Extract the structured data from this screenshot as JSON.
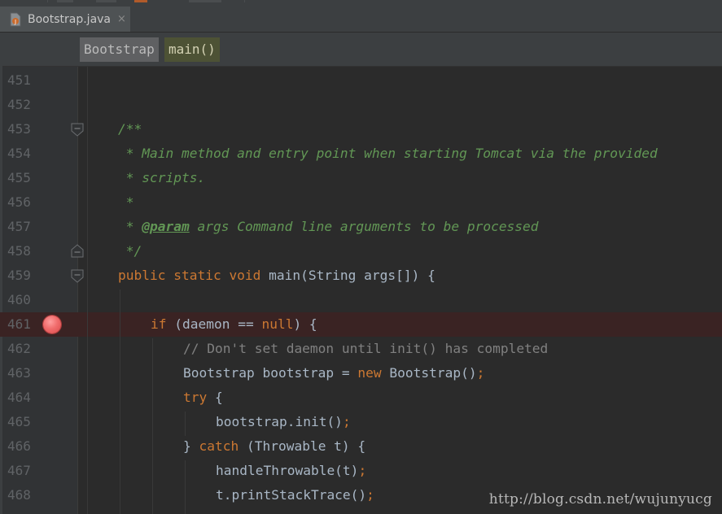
{
  "tab": {
    "title": "Bootstrap.java",
    "close": "×"
  },
  "breadcrumb": {
    "class_name": "Bootstrap",
    "method_name": "main()"
  },
  "lines": [
    {
      "n": "451"
    },
    {
      "n": "452"
    },
    {
      "n": "453"
    },
    {
      "n": "454"
    },
    {
      "n": "455"
    },
    {
      "n": "456"
    },
    {
      "n": "457"
    },
    {
      "n": "458"
    },
    {
      "n": "459"
    },
    {
      "n": "460"
    },
    {
      "n": "461"
    },
    {
      "n": "462"
    },
    {
      "n": "463"
    },
    {
      "n": "464"
    },
    {
      "n": "465"
    },
    {
      "n": "466"
    },
    {
      "n": "467"
    },
    {
      "n": "468"
    }
  ],
  "code": {
    "l453": "/**",
    "l454": " * Main method and entry point when starting Tomcat via the provided",
    "l455": " * scripts.",
    "l456": " *",
    "l457_star": " * ",
    "l457_tag": "@param",
    "l457_rest": " args Command line arguments to be processed",
    "l458": " */",
    "l459_kw": "public static void",
    "l459_rest": " main(String args[]) {",
    "l461_kw": "if",
    "l461_a": " (daemon == ",
    "l461_null": "null",
    "l461_b": ") {",
    "l462": "// Don't set daemon until init() has completed",
    "l463_a": "Bootstrap bootstrap = ",
    "l463_new": "new",
    "l463_b": " Bootstrap()",
    "l464_kw": "try",
    "l464_b": " {",
    "l465": "bootstrap.init()",
    "l466_a": "} ",
    "l466_kw": "catch",
    "l466_b": " (Throwable t) {",
    "l467": "handleThrowable(t)",
    "l468": "t.printStackTrace()",
    "semicolon": ";"
  },
  "breakpoint_line": "461",
  "watermark": "http://blog.csdn.net/wujunyucg",
  "colors": {
    "background": "#2b2b2b",
    "keyword": "#cc7832",
    "comment": "#808080",
    "javadoc": "#629755",
    "breakpoint": "#f06c6c"
  }
}
